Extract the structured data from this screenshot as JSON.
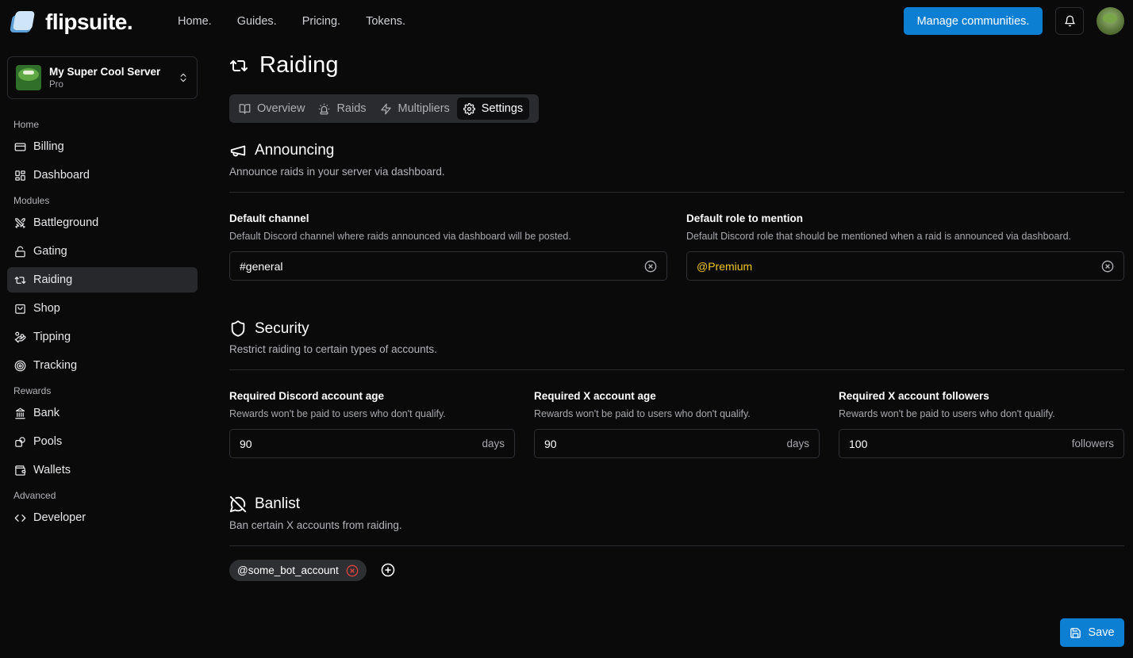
{
  "app": {
    "name": "flipsuite."
  },
  "topnav": [
    "Home.",
    "Guides.",
    "Pricing.",
    "Tokens."
  ],
  "header": {
    "manage_label": "Manage communities."
  },
  "server": {
    "name": "My Super Cool Server",
    "plan": "Pro"
  },
  "sidebar": {
    "sections": [
      {
        "label": "Home",
        "items": [
          {
            "label": "Billing",
            "icon": "credit-card-icon"
          },
          {
            "label": "Dashboard",
            "icon": "dashboard-icon"
          }
        ]
      },
      {
        "label": "Modules",
        "items": [
          {
            "label": "Battleground",
            "icon": "swords-icon"
          },
          {
            "label": "Gating",
            "icon": "lock-icon"
          },
          {
            "label": "Raiding",
            "icon": "repeat-icon",
            "active": true
          },
          {
            "label": "Shop",
            "icon": "shopping-bag-icon"
          },
          {
            "label": "Tipping",
            "icon": "tip-hand-icon"
          },
          {
            "label": "Tracking",
            "icon": "target-icon"
          }
        ]
      },
      {
        "label": "Rewards",
        "items": [
          {
            "label": "Bank",
            "icon": "bank-icon"
          },
          {
            "label": "Pools",
            "icon": "pools-icon"
          },
          {
            "label": "Wallets",
            "icon": "wallet-icon"
          }
        ]
      },
      {
        "label": "Advanced",
        "items": [
          {
            "label": "Developer",
            "icon": "code-icon"
          }
        ]
      }
    ]
  },
  "page": {
    "title": "Raiding"
  },
  "tabs": [
    {
      "label": "Overview",
      "icon": "book-open-icon"
    },
    {
      "label": "Raids",
      "icon": "siren-icon"
    },
    {
      "label": "Multipliers",
      "icon": "zap-icon"
    },
    {
      "label": "Settings",
      "icon": "gear-icon",
      "active": true
    }
  ],
  "announcing": {
    "title": "Announcing",
    "subtitle": "Announce raids in your server via dashboard.",
    "channel": {
      "label": "Default channel",
      "desc": "Default Discord channel where raids announced via dashboard will be posted.",
      "value": "#general"
    },
    "role": {
      "label": "Default role to mention",
      "desc": "Default Discord role that should be mentioned when a raid is announced via dashboard.",
      "value": "@Premium",
      "color": "#f0c52b"
    }
  },
  "security": {
    "title": "Security",
    "subtitle": "Restrict raiding to certain types of accounts.",
    "fields": [
      {
        "label": "Required Discord account age",
        "desc": "Rewards won't be paid to users who don't qualify.",
        "value": "90",
        "suffix": "days"
      },
      {
        "label": "Required X account age",
        "desc": "Rewards won't be paid to users who don't qualify.",
        "value": "90",
        "suffix": "days"
      },
      {
        "label": "Required X account followers",
        "desc": "Rewards won't be paid to users who don't qualify.",
        "value": "100",
        "suffix": "followers"
      }
    ]
  },
  "banlist": {
    "title": "Banlist",
    "subtitle": "Ban certain X accounts from raiding.",
    "entries": [
      "@some_bot_account"
    ]
  },
  "footer": {
    "save_label": "Save"
  },
  "colors": {
    "accent": "#0c7fd2",
    "background": "#0a0a0b",
    "danger": "#e0433f"
  }
}
